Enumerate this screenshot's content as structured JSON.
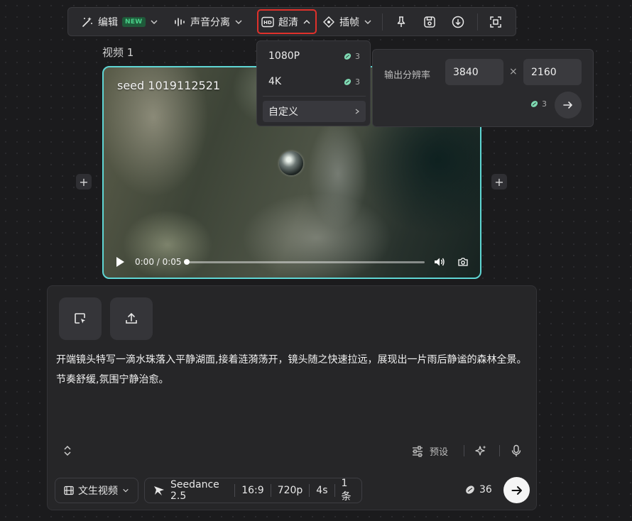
{
  "toolbar": {
    "edit_label": "编辑",
    "new_badge": "NEW",
    "audio_split_label": "声音分离",
    "hd_label": "超清",
    "interpolate_label": "插帧",
    "icons": [
      "magic-wand-icon",
      "audio-wave-icon",
      "hd-icon",
      "frame-icon",
      "pin-icon",
      "save-icon",
      "download-icon",
      "fullscreen-icon"
    ]
  },
  "hd_menu": {
    "options": [
      {
        "label": "1080P",
        "cost": "3"
      },
      {
        "label": "4K",
        "cost": "3"
      }
    ],
    "custom_label": "自定义"
  },
  "resolution_panel": {
    "label": "输出分辨率",
    "width": "3840",
    "height": "2160",
    "separator": "×",
    "cost": "3"
  },
  "video": {
    "title": "视频 1",
    "seed_label": "seed 1019112521",
    "time": "0:00 / 0:05",
    "progress": 0
  },
  "composer": {
    "prompt": "开端镜头特写一滴水珠落入平静湖面,接着涟漪荡开，镜头随之快速拉远，展现出一片雨后静谧的森林全景。节奏舒缓,氛围宁静治愈。",
    "preset_label": "预设",
    "mode_label": "文生视频",
    "model": {
      "name": "Seedance 2.5",
      "ratio": "16:9",
      "resolution": "720p",
      "duration": "4s",
      "count": "1条"
    },
    "total_cost": "36"
  },
  "colors": {
    "accent_border": "#5fd6d4",
    "highlight_box": "#e0312b",
    "new_badge_text": "#49d28a",
    "bean_icon": "#7fdcb4"
  }
}
